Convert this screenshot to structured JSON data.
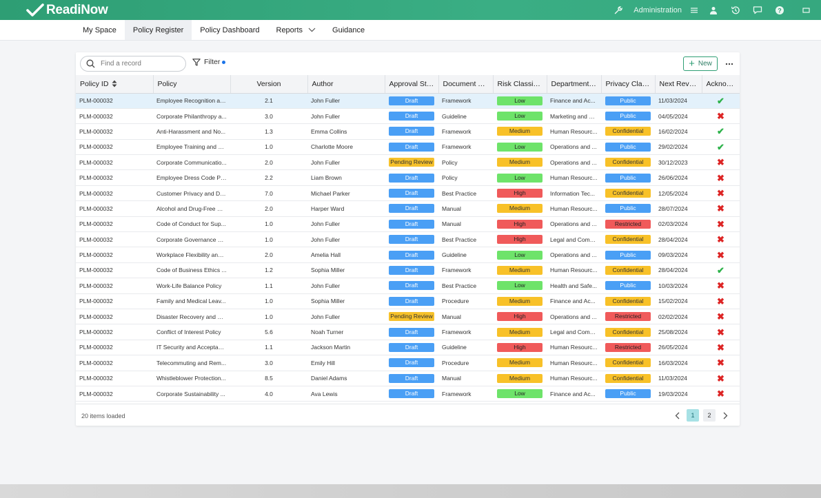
{
  "app": {
    "name": "ReadiNow"
  },
  "topbar": {
    "admin_label": "Administration"
  },
  "nav": {
    "items": [
      {
        "label": "My Space"
      },
      {
        "label": "Policy Register"
      },
      {
        "label": "Policy Dashboard"
      },
      {
        "label": "Reports"
      },
      {
        "label": "Guidance"
      }
    ]
  },
  "toolbar": {
    "search_placeholder": "Find a record",
    "filter_label": "Filter",
    "new_label": "New"
  },
  "table": {
    "headers": [
      "Policy ID",
      "Policy",
      "Version",
      "Author",
      "Approval Stat...",
      "Document Ty...",
      "Risk Classific...",
      "Departmenta...",
      "Privacy Class...",
      "Next Revie...",
      "Acknow..."
    ],
    "rows": [
      {
        "id": "PLM-000032",
        "policy": "Employee Recognition an...",
        "version": "2.1",
        "author": "John Fuller",
        "approval": "Draft",
        "doc": "Framework",
        "risk": "Low",
        "dept": "Finance and Ac...",
        "privacy": "Public",
        "review": "11/03/2024",
        "ack": "✔"
      },
      {
        "id": "PLM-000032",
        "policy": "Corporate Philanthropy a...",
        "version": "3.0",
        "author": "John Fuller",
        "approval": "Draft",
        "doc": "Guideline",
        "risk": "Low",
        "dept": "Marketing and C...",
        "privacy": "Public",
        "review": "04/05/2024",
        "ack": "✖"
      },
      {
        "id": "PLM-000032",
        "policy": "Anti-Harassment and No...",
        "version": "1.3",
        "author": "Emma Collins",
        "approval": "Draft",
        "doc": "Framework",
        "risk": "Medium",
        "dept": "Human Resourc...",
        "privacy": "Confidential",
        "review": "16/02/2024",
        "ack": "✔"
      },
      {
        "id": "PLM-000032",
        "policy": "Employee Training and D...",
        "version": "1.0",
        "author": "Charlotte Moore",
        "approval": "Draft",
        "doc": "Framework",
        "risk": "Low",
        "dept": "Operations and ...",
        "privacy": "Public",
        "review": "29/02/2024",
        "ack": "✔"
      },
      {
        "id": "PLM-000032",
        "policy": "Corporate Communicatio...",
        "version": "2.0",
        "author": "John Fuller",
        "approval": "Pending Review",
        "doc": "Policy",
        "risk": "Medium",
        "dept": "Operations and ...",
        "privacy": "Confidential",
        "review": "30/12/2023",
        "ack": "✖"
      },
      {
        "id": "PLM-000032",
        "policy": "Employee Dress Code Po...",
        "version": "2.2",
        "author": "Liam Brown",
        "approval": "Draft",
        "doc": "Policy",
        "risk": "Low",
        "dept": "Human Resourc...",
        "privacy": "Public",
        "review": "26/06/2024",
        "ack": "✖"
      },
      {
        "id": "PLM-000032",
        "policy": "Customer Privacy and Da...",
        "version": "7.0",
        "author": "Michael Parker",
        "approval": "Draft",
        "doc": "Best Practice",
        "risk": "High",
        "dept": "Information Tec...",
        "privacy": "Confidential",
        "review": "12/05/2024",
        "ack": "✖"
      },
      {
        "id": "PLM-000032",
        "policy": "Alcohol and Drug-Free W...",
        "version": "2.0",
        "author": "Harper Ward",
        "approval": "Draft",
        "doc": "Manual",
        "risk": "Medium",
        "dept": "Human Resourc...",
        "privacy": "Public",
        "review": "28/07/2024",
        "ack": "✖"
      },
      {
        "id": "PLM-000032",
        "policy": "Code of Conduct for Sup...",
        "version": "1.0",
        "author": "John Fuller",
        "approval": "Draft",
        "doc": "Manual",
        "risk": "High",
        "dept": "Operations and ...",
        "privacy": "Restricted",
        "review": "02/03/2024",
        "ack": "✖"
      },
      {
        "id": "PLM-000032",
        "policy": "Corporate Governance an...",
        "version": "1.0",
        "author": "John Fuller",
        "approval": "Draft",
        "doc": "Best Practice",
        "risk": "High",
        "dept": "Legal and Comp...",
        "privacy": "Confidential",
        "review": "28/04/2024",
        "ack": "✖"
      },
      {
        "id": "PLM-000032",
        "policy": "Workplace Flexibility and ...",
        "version": "2.0",
        "author": "Amelia Hall",
        "approval": "Draft",
        "doc": "Guideline",
        "risk": "Low",
        "dept": "Operations and ...",
        "privacy": "Public",
        "review": "09/03/2024",
        "ack": "✖"
      },
      {
        "id": "PLM-000032",
        "policy": "Code of Business Ethics ...",
        "version": "1.2",
        "author": "Sophia Miller",
        "approval": "Draft",
        "doc": "Framework",
        "risk": "Medium",
        "dept": "Human Resourc...",
        "privacy": "Confidential",
        "review": "28/04/2024",
        "ack": "✔"
      },
      {
        "id": "PLM-000032",
        "policy": "Work-Life Balance Policy",
        "version": "1.1",
        "author": "John Fuller",
        "approval": "Draft",
        "doc": "Best Practice",
        "risk": "Low",
        "dept": "Health and Safe...",
        "privacy": "Public",
        "review": "10/03/2024",
        "ack": "✖"
      },
      {
        "id": "PLM-000032",
        "policy": "Family and Medical Leav...",
        "version": "1.0",
        "author": "Sophia Miller",
        "approval": "Draft",
        "doc": "Procedure",
        "risk": "Medium",
        "dept": "Finance and Ac...",
        "privacy": "Confidential",
        "review": "15/02/2024",
        "ack": "✖"
      },
      {
        "id": "PLM-000032",
        "policy": "Disaster Recovery and Bu...",
        "version": "1.0",
        "author": "John Fuller",
        "approval": "Pending Review",
        "doc": "Manual",
        "risk": "High",
        "dept": "Operations and ...",
        "privacy": "Restricted",
        "review": "02/02/2024",
        "ack": "✖"
      },
      {
        "id": "PLM-000032",
        "policy": "Conflict of Interest Policy",
        "version": "5.6",
        "author": "Noah Turner",
        "approval": "Draft",
        "doc": "Framework",
        "risk": "Medium",
        "dept": "Legal and Comp...",
        "privacy": "Confidential",
        "review": "25/08/2024",
        "ack": "✖"
      },
      {
        "id": "PLM-000032",
        "policy": "IT Security and Acceptabl...",
        "version": "1.1",
        "author": "Jackson Martin",
        "approval": "Draft",
        "doc": "Guideline",
        "risk": "High",
        "dept": "Human Resourc...",
        "privacy": "Restricted",
        "review": "26/05/2024",
        "ack": "✖"
      },
      {
        "id": "PLM-000032",
        "policy": "Telecommuting and Rem...",
        "version": "3.0",
        "author": "Emily Hill",
        "approval": "Draft",
        "doc": "Procedure",
        "risk": "Medium",
        "dept": "Human Resourc...",
        "privacy": "Confidential",
        "review": "16/03/2024",
        "ack": "✖"
      },
      {
        "id": "PLM-000032",
        "policy": "Whistleblower Protection...",
        "version": "8.5",
        "author": "Daniel Adams",
        "approval": "Draft",
        "doc": "Manual",
        "risk": "Medium",
        "dept": "Human Resourc...",
        "privacy": "Confidential",
        "review": "11/03/2024",
        "ack": "✖"
      },
      {
        "id": "PLM-000032",
        "policy": "Corporate Sustainability ...",
        "version": "4.0",
        "author": "Ava Lewis",
        "approval": "Draft",
        "doc": "Framework",
        "risk": "Low",
        "dept": "Finance and Ac...",
        "privacy": "Public",
        "review": "19/03/2024",
        "ack": "✖"
      }
    ]
  },
  "footer": {
    "loaded_text": "20 items loaded",
    "pages": [
      "1",
      "2"
    ],
    "current_page": "1"
  },
  "colors": {
    "brand": "#2e9e74",
    "draft": "#4a9ff5",
    "pending": "#f6c12b",
    "low": "#6ee36a",
    "medium": "#f8c128",
    "high": "#f05a5a",
    "ack_yes": "#2db24a",
    "ack_no": "#dd2525"
  }
}
